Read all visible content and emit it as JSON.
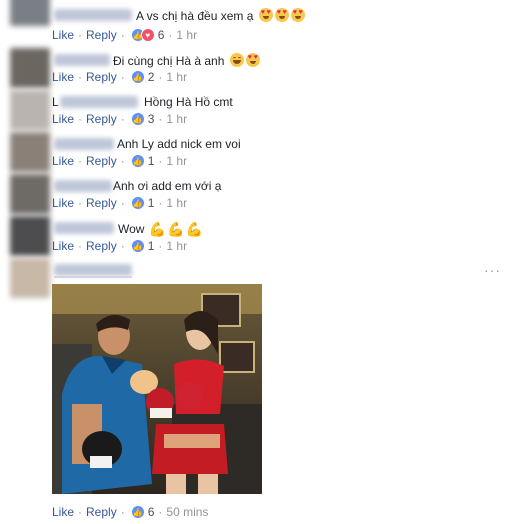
{
  "actions": {
    "like": "Like",
    "reply": "Reply",
    "dot": "·"
  },
  "comments": [
    {
      "text": "A vs chị hà đều xem ạ",
      "reactions": "6",
      "time": "1 hr"
    },
    {
      "text": "Đi cùng chị Hà à anh",
      "reactions": "2",
      "time": "1 hr"
    },
    {
      "text": "Hồng Hà Hồ cmt",
      "reactions": "3",
      "time": "1 hr"
    },
    {
      "text": "Anh Ly add nick em voi",
      "reactions": "1",
      "time": "1 hr"
    },
    {
      "text": "Anh ơi add em với ạ",
      "reactions": "1",
      "time": "1 hr"
    },
    {
      "text": "Wow",
      "reactions": "1",
      "time": "1 hr"
    },
    {
      "text": "",
      "reactions": "6",
      "time": "50 mins"
    }
  ],
  "colors": {
    "link": "#365899",
    "meta": "#90949c",
    "like_reaction": "#5890ff",
    "love_reaction": "#f25268"
  },
  "icons": {
    "more": "more-options-icon"
  },
  "more_glyph": "···"
}
